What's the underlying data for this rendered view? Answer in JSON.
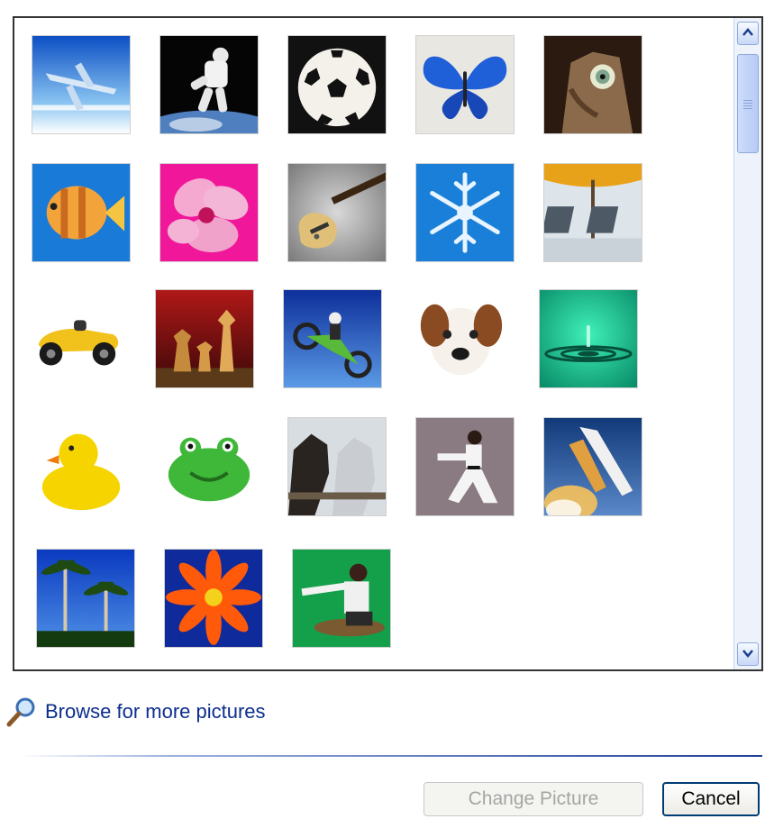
{
  "dialog": {
    "pictures": [
      {
        "icon": "airplane"
      },
      {
        "icon": "astronaut"
      },
      {
        "icon": "soccer-ball"
      },
      {
        "icon": "butterfly"
      },
      {
        "icon": "cat"
      },
      {
        "icon": "fish"
      },
      {
        "icon": "flower-pink"
      },
      {
        "icon": "guitar"
      },
      {
        "icon": "snowflake"
      },
      {
        "icon": "beach-chairs"
      },
      {
        "icon": "race-car"
      },
      {
        "icon": "chess"
      },
      {
        "icon": "dirt-bike"
      },
      {
        "icon": "dog"
      },
      {
        "icon": "water-drop"
      },
      {
        "icon": "rubber-duck"
      },
      {
        "icon": "frog"
      },
      {
        "icon": "horses"
      },
      {
        "icon": "karate"
      },
      {
        "icon": "space-shuttle"
      },
      {
        "icon": "palm-trees"
      },
      {
        "icon": "orange-flower"
      },
      {
        "icon": "skateboarder"
      }
    ],
    "browse_label": "Browse for more pictures",
    "change_picture_label": "Change Picture",
    "change_picture_enabled": false,
    "cancel_label": "Cancel"
  }
}
